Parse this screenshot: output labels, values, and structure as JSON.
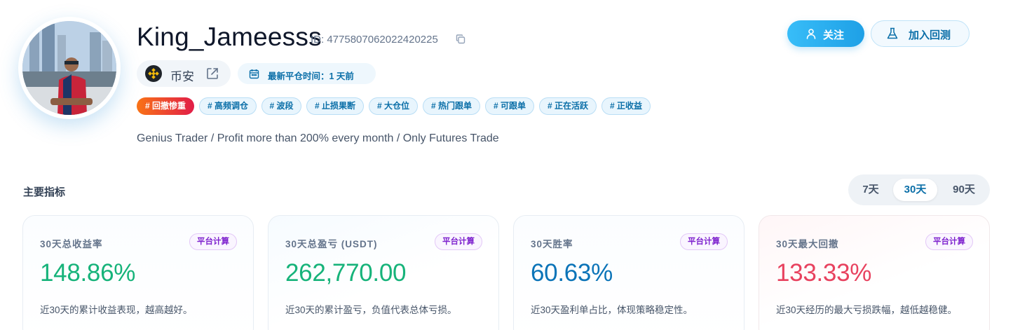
{
  "profile": {
    "name": "King_Jameesss",
    "id_text": "ID: 4775807062022420225",
    "exchange": "币安",
    "last_close": "最新平仓时间：1 天前",
    "bio": "Genius Trader / Profit more than 200% every month / Only Futures Trade"
  },
  "tags": [
    "# 回撤惨重",
    "# 高频调仓",
    "# 波段",
    "# 止损果断",
    "# 大仓位",
    "# 热门跟单",
    "# 可跟单",
    "# 正在活跃",
    "# 正收益"
  ],
  "actions": {
    "follow": "关注",
    "backtest": "加入回测"
  },
  "section": {
    "title": "主要指标"
  },
  "periods": {
    "items": [
      "7天",
      "30天",
      "90天"
    ],
    "selected": "30天"
  },
  "metrics": [
    {
      "label": "30天总收益率",
      "badge": "平台计算",
      "value": "148.86%",
      "desc": "近30天的累计收益表现，越高越好。",
      "color": "#16b37a"
    },
    {
      "label": "30天总盈亏 (USDT)",
      "badge": "平台计算",
      "value": "262,770.00",
      "desc": "近30天的累计盈亏，负值代表总体亏损。",
      "color": "#16b37a"
    },
    {
      "label": "30天胜率",
      "badge": "平台计算",
      "value": "60.63%",
      "desc": "近30天盈利单占比，体现策略稳定性。",
      "color": "#0b74b8"
    },
    {
      "label": "30天最大回撤",
      "badge": "平台计算",
      "value": "133.33%",
      "desc": "近30天经历的最大亏损跌幅，越低越稳健。",
      "color": "#e8425f"
    }
  ],
  "icons": {
    "copy": "copy-icon",
    "exchange_logo": "binance-logo-icon",
    "external": "external-link-icon",
    "calendar": "calendar-icon",
    "follow": "user-icon",
    "backtest": "flask-icon"
  },
  "colors": {
    "accent": "#1ea0e6",
    "positive": "#16b37a",
    "negative": "#e8425f",
    "win_rate": "#0b74b8",
    "tag_hot": "#e11d48"
  }
}
